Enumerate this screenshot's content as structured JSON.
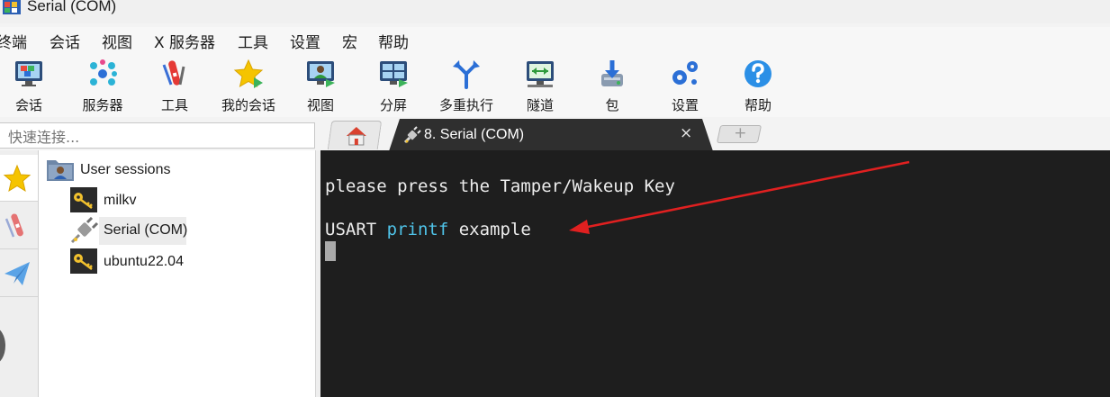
{
  "window": {
    "title": "Serial (COM)"
  },
  "menu": [
    "终端",
    "会话",
    "视图",
    "X 服务器",
    "工具",
    "设置",
    "宏",
    "帮助"
  ],
  "toolbar": {
    "session": "会话",
    "servers": "服务器",
    "tools": "工具",
    "my_sessions": "我的会话",
    "view": "视图",
    "split": "分屏",
    "multiexec": "多重执行",
    "tunnel": "隧道",
    "packages": "包",
    "settings": "设置",
    "help": "帮助"
  },
  "quick_connect": {
    "placeholder": "快速连接..."
  },
  "tabs": {
    "active_title": "8. Serial (COM)",
    "close_glyph": "×"
  },
  "sessions": {
    "root": "User sessions",
    "items": [
      "milkv",
      "Serial (COM)",
      "ubuntu22.04"
    ]
  },
  "terminal": {
    "line1": "please press the Tamper/Wakeup Key",
    "line2_a": "USART ",
    "line2_kw": "printf",
    "line2_b": " example"
  },
  "colors": {
    "terminal_bg": "#1e1e1e",
    "keyword": "#4fc3e8",
    "annotation_arrow": "#e02020"
  }
}
